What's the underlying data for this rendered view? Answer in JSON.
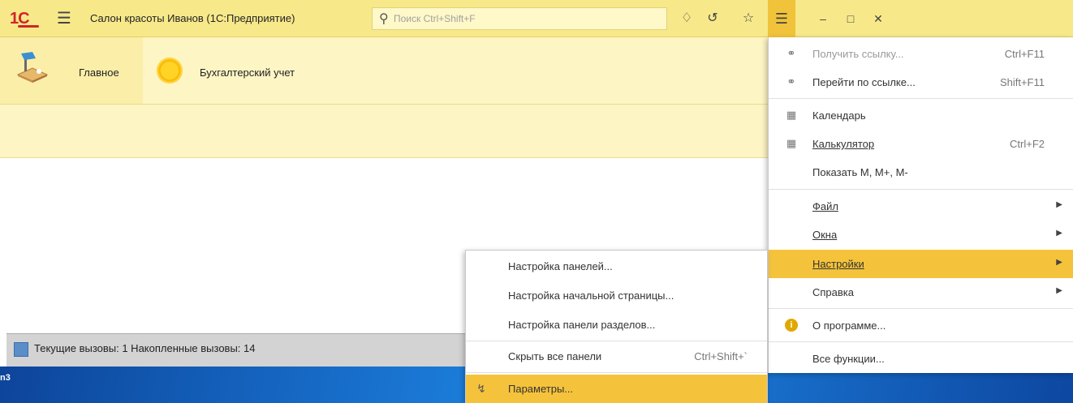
{
  "titlebar": {
    "logo": "1С",
    "app_title": "Салон красоты Иванов  (1С:Предприятие)",
    "search_placeholder": "Поиск Ctrl+Shift+F"
  },
  "sections": [
    {
      "label": "Главное",
      "icon": "desk-lamp-icon"
    },
    {
      "label": "Бухгалтерский учет",
      "icon": "coin-icon"
    }
  ],
  "status": {
    "text": "Текущие вызовы: 1   Накопленные вызовы: 14"
  },
  "taskbar": {
    "label": "n3"
  },
  "main_menu": {
    "items": [
      {
        "label": "Получить ссылку...",
        "shortcut": "Ctrl+F11",
        "icon": "link-icon",
        "disabled": true
      },
      {
        "label": "Перейти по ссылке...",
        "shortcut": "Shift+F11",
        "icon": "link-go-icon"
      },
      {
        "label": "Календарь",
        "icon": "calendar-icon"
      },
      {
        "label": "Калькулятор",
        "shortcut": "Ctrl+F2",
        "icon": "calculator-icon"
      },
      {
        "label": "Показать М, М+, М-"
      },
      {
        "label": "Файл",
        "submenu": true
      },
      {
        "label": "Окна",
        "submenu": true
      },
      {
        "label": "Настройки",
        "submenu": true,
        "highlighted": true
      },
      {
        "label": "Справка",
        "submenu": true
      },
      {
        "label": "О программе...",
        "icon": "info-icon"
      },
      {
        "label": "Все функции..."
      }
    ]
  },
  "settings_submenu": {
    "items": [
      {
        "label": "Настройка панелей..."
      },
      {
        "label": "Настройка начальной страницы..."
      },
      {
        "label": "Настройка панели разделов..."
      },
      {
        "label": "Скрыть все панели",
        "shortcut": "Ctrl+Shift+`"
      },
      {
        "label": "Параметры...",
        "icon": "wrench-icon",
        "highlighted": true
      }
    ]
  },
  "colors": {
    "titlebar": "#f7e98a",
    "sections_bg": "#fdf5c4",
    "highlight": "#f5c33b",
    "logo_red": "#d1242a"
  }
}
